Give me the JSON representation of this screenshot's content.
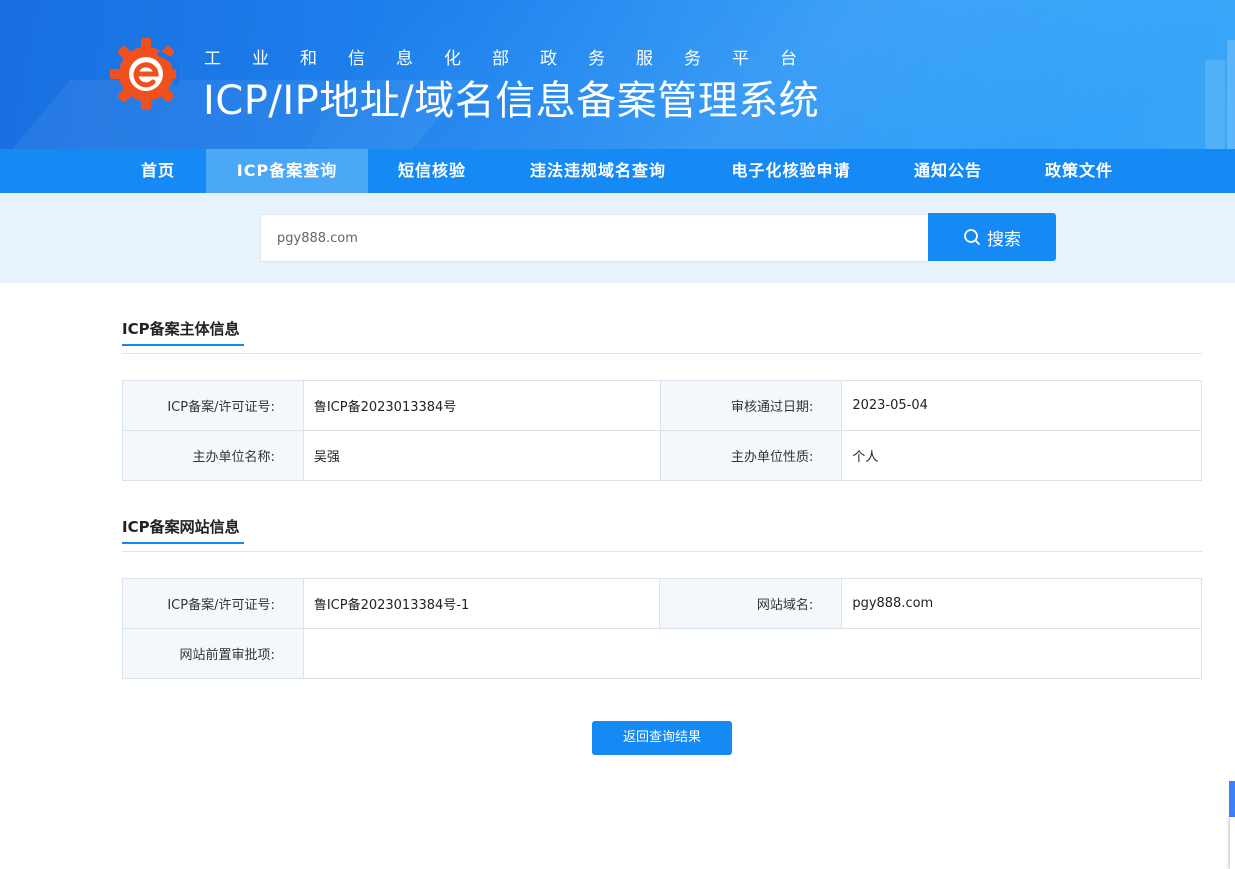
{
  "header": {
    "subtitle": "工业和信息化部政务服务平台",
    "title": "ICP/IP地址/域名信息备案管理系统"
  },
  "nav": {
    "items": [
      {
        "label": "首页"
      },
      {
        "label": "ICP备案查询",
        "active": true
      },
      {
        "label": "短信核验"
      },
      {
        "label": "违法违规域名查询"
      },
      {
        "label": "电子化核验申请"
      },
      {
        "label": "通知公告"
      },
      {
        "label": "政策文件"
      }
    ]
  },
  "search": {
    "value": "pgy888.com",
    "button_label": "搜索"
  },
  "subject_section": {
    "title": "ICP备案主体信息",
    "rows": [
      {
        "label1": "ICP备案/许可证号:",
        "value1": "鲁ICP备2023013384号",
        "label2": "审核通过日期:",
        "value2": "2023-05-04"
      },
      {
        "label1": "主办单位名称:",
        "value1": "吴强",
        "label2": "主办单位性质:",
        "value2": "个人"
      }
    ]
  },
  "website_section": {
    "title": "ICP备案网站信息",
    "row1": {
      "label1": "ICP备案/许可证号:",
      "value1": "鲁ICP备2023013384号-1",
      "label2": "网站域名:",
      "value2": "pgy888.com"
    },
    "row2": {
      "label": "网站前置审批项:",
      "value": ""
    }
  },
  "back_button": "返回查询结果",
  "colors": {
    "primary": "#1589f4",
    "nav_active": "#4aa8f6",
    "logo_orange": "#f0501e"
  }
}
